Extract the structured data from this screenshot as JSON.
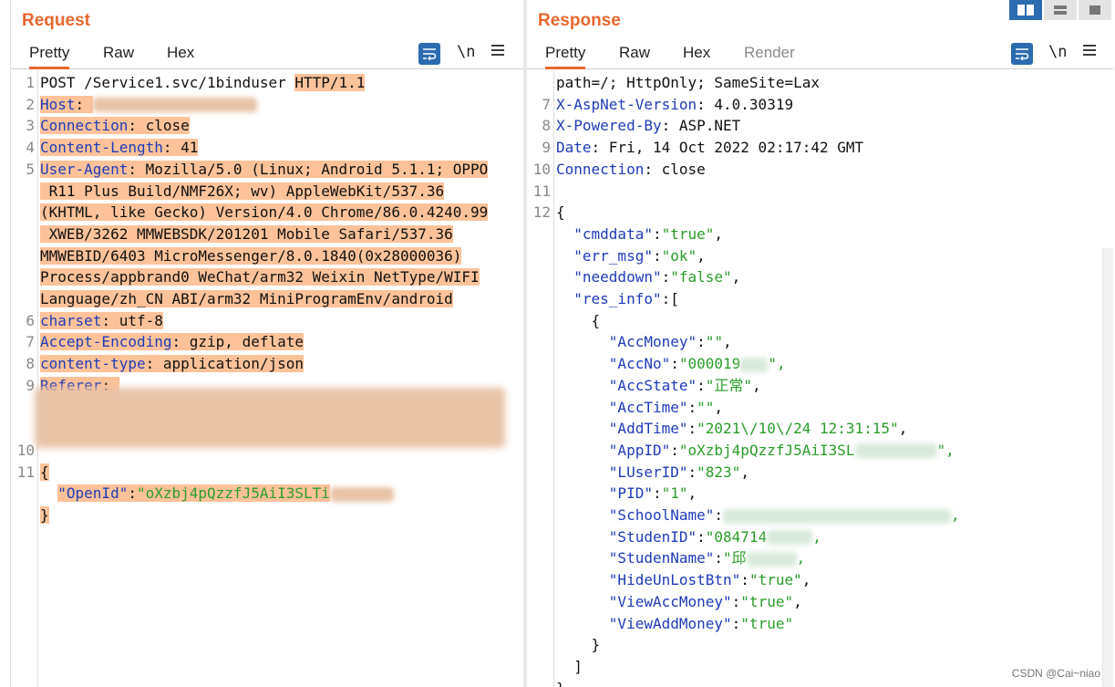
{
  "request": {
    "title": "Request",
    "tabs": [
      "Pretty",
      "Raw",
      "Hex"
    ],
    "wrap_label": "\\n",
    "lines": [
      {
        "n": "1",
        "segs": [
          {
            "t": "POST /Service1.svc/1binduser ",
            "c": "v"
          },
          {
            "t": "HTTP/1.1",
            "c": "v",
            "hl": true
          }
        ]
      },
      {
        "n": "2",
        "segs": [
          {
            "t": "Host",
            "c": "k",
            "hl": true
          },
          {
            "t": ": ",
            "c": "v",
            "hl": true
          }
        ],
        "blur": 180
      },
      {
        "n": "3",
        "segs": [
          {
            "t": "Connection",
            "c": "k",
            "hl": true
          },
          {
            "t": ": close",
            "c": "v",
            "hl": true
          }
        ]
      },
      {
        "n": "4",
        "segs": [
          {
            "t": "Content-Length",
            "c": "k",
            "hl": true
          },
          {
            "t": ": 41",
            "c": "v",
            "hl": true
          }
        ]
      },
      {
        "n": "5",
        "segs": [
          {
            "t": "User-Agent",
            "c": "k",
            "hl": true
          },
          {
            "t": ": Mozilla/5.0 (Linux; Android 5.1.1; OPPO",
            "c": "v",
            "hl": true
          }
        ]
      },
      {
        "n": "",
        "segs": [
          {
            "t": " R11 Plus Build/NMF26X; wv) AppleWebKit/537.36",
            "c": "v",
            "hl": true
          }
        ]
      },
      {
        "n": "",
        "segs": [
          {
            "t": "(KHTML, like Gecko) Version/4.0 Chrome/86.0.4240.99",
            "c": "v",
            "hl": true
          }
        ]
      },
      {
        "n": "",
        "segs": [
          {
            "t": " XWEB/3262 MMWEBSDK/201201 Mobile Safari/537.36",
            "c": "v",
            "hl": true
          }
        ]
      },
      {
        "n": "",
        "segs": [
          {
            "t": "MMWEBID/6403 MicroMessenger/8.0.1840(0x28000036)",
            "c": "v",
            "hl": true
          }
        ]
      },
      {
        "n": "",
        "segs": [
          {
            "t": "Process/appbrand0 WeChat/arm32 Weixin NetType/WIFI",
            "c": "v",
            "hl": true
          }
        ]
      },
      {
        "n": "",
        "segs": [
          {
            "t": "Language/zh_CN ABI/arm32 MiniProgramEnv/android",
            "c": "v",
            "hl": true
          }
        ]
      },
      {
        "n": "6",
        "segs": [
          {
            "t": "charset",
            "c": "k",
            "hl": true
          },
          {
            "t": ": utf-8",
            "c": "v",
            "hl": true
          }
        ]
      },
      {
        "n": "7",
        "segs": [
          {
            "t": "Accept-Encoding",
            "c": "k",
            "hl": true
          },
          {
            "t": ": gzip, deflate",
            "c": "v",
            "hl": true
          }
        ]
      },
      {
        "n": "8",
        "segs": [
          {
            "t": "content-type",
            "c": "k",
            "hl": true
          },
          {
            "t": ": application/json",
            "c": "v",
            "hl": true
          }
        ]
      },
      {
        "n": "9",
        "segs": [
          {
            "t": "Referer",
            "c": "k",
            "hl": true
          },
          {
            "t": ": ",
            "c": "v",
            "hl": true
          }
        ]
      },
      {
        "n": "",
        "segs": [
          {
            "t": "",
            "c": "v"
          }
        ],
        "blur_block": true
      },
      {
        "n": "",
        "segs": [
          {
            "t": "",
            "c": "v"
          }
        ]
      },
      {
        "n": "10",
        "segs": [
          {
            "t": "",
            "c": "v"
          }
        ]
      },
      {
        "n": "11",
        "segs": [
          {
            "t": "{",
            "c": "v",
            "hl": true
          }
        ]
      },
      {
        "n": "",
        "segs": [
          {
            "t": "  ",
            "c": "v"
          },
          {
            "t": "\"OpenId\"",
            "c": "k",
            "hl": true
          },
          {
            "t": ":",
            "c": "v",
            "hl": true
          },
          {
            "t": "\"oXzbj4pQzzfJ5AiI3SLTi",
            "c": "s",
            "hl": true
          }
        ],
        "blur": 70
      },
      {
        "n": "",
        "segs": [
          {
            "t": "}",
            "c": "v",
            "hl": true
          }
        ]
      }
    ]
  },
  "response": {
    "title": "Response",
    "tabs": [
      "Pretty",
      "Raw",
      "Hex",
      "Render"
    ],
    "wrap_label": "\\n",
    "watermark": "CSDN @Cai~niao",
    "lines": [
      {
        "n": "",
        "segs": [
          {
            "t": "path=/; HttpOnly; SameSite=Lax",
            "c": "v"
          }
        ]
      },
      {
        "n": "7",
        "segs": [
          {
            "t": "X-AspNet-Version",
            "c": "k"
          },
          {
            "t": ": 4.0.30319",
            "c": "v"
          }
        ]
      },
      {
        "n": "8",
        "segs": [
          {
            "t": "X-Powered-By",
            "c": "k"
          },
          {
            "t": ": ASP.NET",
            "c": "v"
          }
        ]
      },
      {
        "n": "9",
        "segs": [
          {
            "t": "Date",
            "c": "k"
          },
          {
            "t": ": Fri, 14 Oct 2022 02:17:42 GMT",
            "c": "v"
          }
        ]
      },
      {
        "n": "10",
        "segs": [
          {
            "t": "Connection",
            "c": "k"
          },
          {
            "t": ": close",
            "c": "v"
          }
        ]
      },
      {
        "n": "11",
        "segs": [
          {
            "t": "",
            "c": "v"
          }
        ]
      },
      {
        "n": "12",
        "segs": [
          {
            "t": "{",
            "c": "v"
          }
        ]
      },
      {
        "n": "",
        "segs": [
          {
            "t": "  ",
            "c": "v"
          },
          {
            "t": "\"cmddata\"",
            "c": "k"
          },
          {
            "t": ":",
            "c": "v"
          },
          {
            "t": "\"true\"",
            "c": "s"
          },
          {
            "t": ",",
            "c": "v"
          }
        ]
      },
      {
        "n": "",
        "segs": [
          {
            "t": "  ",
            "c": "v"
          },
          {
            "t": "\"err_msg\"",
            "c": "k"
          },
          {
            "t": ":",
            "c": "v"
          },
          {
            "t": "\"ok\"",
            "c": "s"
          },
          {
            "t": ",",
            "c": "v"
          }
        ]
      },
      {
        "n": "",
        "segs": [
          {
            "t": "  ",
            "c": "v"
          },
          {
            "t": "\"needdown\"",
            "c": "k"
          },
          {
            "t": ":",
            "c": "v"
          },
          {
            "t": "\"false\"",
            "c": "s"
          },
          {
            "t": ",",
            "c": "v"
          }
        ]
      },
      {
        "n": "",
        "segs": [
          {
            "t": "  ",
            "c": "v"
          },
          {
            "t": "\"res_info\"",
            "c": "k"
          },
          {
            "t": ":[",
            "c": "v"
          }
        ]
      },
      {
        "n": "",
        "segs": [
          {
            "t": "    {",
            "c": "v"
          }
        ]
      },
      {
        "n": "",
        "segs": [
          {
            "t": "      ",
            "c": "v"
          },
          {
            "t": "\"AccMoney\"",
            "c": "k"
          },
          {
            "t": ":",
            "c": "v"
          },
          {
            "t": "\"\"",
            "c": "s"
          },
          {
            "t": ",",
            "c": "v"
          }
        ]
      },
      {
        "n": "",
        "segs": [
          {
            "t": "      ",
            "c": "v"
          },
          {
            "t": "\"AccNo\"",
            "c": "k"
          },
          {
            "t": ":",
            "c": "v"
          },
          {
            "t": "\"000019",
            "c": "s"
          }
        ],
        "blur": 30,
        "after": "\","
      },
      {
        "n": "",
        "segs": [
          {
            "t": "      ",
            "c": "v"
          },
          {
            "t": "\"AccState\"",
            "c": "k"
          },
          {
            "t": ":",
            "c": "v"
          },
          {
            "t": "\"正常\"",
            "c": "s"
          },
          {
            "t": ",",
            "c": "v"
          }
        ]
      },
      {
        "n": "",
        "segs": [
          {
            "t": "      ",
            "c": "v"
          },
          {
            "t": "\"AccTime\"",
            "c": "k"
          },
          {
            "t": ":",
            "c": "v"
          },
          {
            "t": "\"\"",
            "c": "s"
          },
          {
            "t": ",",
            "c": "v"
          }
        ]
      },
      {
        "n": "",
        "segs": [
          {
            "t": "      ",
            "c": "v"
          },
          {
            "t": "\"AddTime\"",
            "c": "k"
          },
          {
            "t": ":",
            "c": "v"
          },
          {
            "t": "\"2021\\/10\\/24 12:31:15\"",
            "c": "s"
          },
          {
            "t": ",",
            "c": "v"
          }
        ]
      },
      {
        "n": "",
        "segs": [
          {
            "t": "      ",
            "c": "v"
          },
          {
            "t": "\"AppID\"",
            "c": "k"
          },
          {
            "t": ":",
            "c": "v"
          },
          {
            "t": "\"oXzbj4pQzzfJ5AiI3SL",
            "c": "s"
          }
        ],
        "blur": 90,
        "after": "\","
      },
      {
        "n": "",
        "segs": [
          {
            "t": "      ",
            "c": "v"
          },
          {
            "t": "\"LUserID\"",
            "c": "k"
          },
          {
            "t": ":",
            "c": "v"
          },
          {
            "t": "\"823\"",
            "c": "s"
          },
          {
            "t": ",",
            "c": "v"
          }
        ]
      },
      {
        "n": "",
        "segs": [
          {
            "t": "      ",
            "c": "v"
          },
          {
            "t": "\"PID\"",
            "c": "k"
          },
          {
            "t": ":",
            "c": "v"
          },
          {
            "t": "\"1\"",
            "c": "s"
          },
          {
            "t": ",",
            "c": "v"
          }
        ]
      },
      {
        "n": "",
        "segs": [
          {
            "t": "      ",
            "c": "v"
          },
          {
            "t": "\"SchoolName\"",
            "c": "k"
          },
          {
            "t": ":",
            "c": "v"
          }
        ],
        "blur": 250,
        "after": ","
      },
      {
        "n": "",
        "segs": [
          {
            "t": "      ",
            "c": "v"
          },
          {
            "t": "\"StudenID\"",
            "c": "k"
          },
          {
            "t": ":",
            "c": "v"
          },
          {
            "t": "\"084714",
            "c": "s"
          }
        ],
        "blur": 50,
        "after": ","
      },
      {
        "n": "",
        "segs": [
          {
            "t": "      ",
            "c": "v"
          },
          {
            "t": "\"StudenName\"",
            "c": "k"
          },
          {
            "t": ":",
            "c": "v"
          },
          {
            "t": "\"邱",
            "c": "s"
          }
        ],
        "blur": 55,
        "after": ","
      },
      {
        "n": "",
        "segs": [
          {
            "t": "      ",
            "c": "v"
          },
          {
            "t": "\"HideUnLostBtn\"",
            "c": "k"
          },
          {
            "t": ":",
            "c": "v"
          },
          {
            "t": "\"true\"",
            "c": "s"
          },
          {
            "t": ",",
            "c": "v"
          }
        ]
      },
      {
        "n": "",
        "segs": [
          {
            "t": "      ",
            "c": "v"
          },
          {
            "t": "\"ViewAccMoney\"",
            "c": "k"
          },
          {
            "t": ":",
            "c": "v"
          },
          {
            "t": "\"true\"",
            "c": "s"
          },
          {
            "t": ",",
            "c": "v"
          }
        ]
      },
      {
        "n": "",
        "segs": [
          {
            "t": "      ",
            "c": "v"
          },
          {
            "t": "\"ViewAddMoney\"",
            "c": "k"
          },
          {
            "t": ":",
            "c": "v"
          },
          {
            "t": "\"true\"",
            "c": "s"
          }
        ]
      },
      {
        "n": "",
        "segs": [
          {
            "t": "    }",
            "c": "v"
          }
        ]
      },
      {
        "n": "",
        "segs": [
          {
            "t": "  ]",
            "c": "v"
          }
        ]
      },
      {
        "n": "",
        "segs": [
          {
            "t": "}",
            "c": "v"
          }
        ]
      }
    ]
  }
}
